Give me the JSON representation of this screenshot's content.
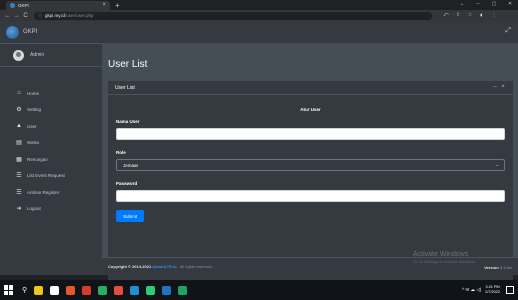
{
  "browser": {
    "tab_title": "GKPI",
    "tab_close": "×",
    "new_tab": "+",
    "window_controls": [
      "⌄",
      "–",
      "▢",
      "✕"
    ],
    "back": "←",
    "forward": "→",
    "reload": "C",
    "lock": "ⓘ",
    "url_host": "gkpi.my.id",
    "url_path": "/user/user.php",
    "toolbar_icons": [
      "⤺",
      "⇪",
      "☆"
    ],
    "profile": "◐",
    "menu": "⋮"
  },
  "topnav": {
    "brand": "GKPI",
    "expand_icon": "⤢"
  },
  "sidebar": {
    "user": "Admin",
    "items": [
      {
        "icon": "⌂",
        "label": "Home"
      },
      {
        "icon": "⚙",
        "label": "Setting"
      },
      {
        "icon": "▲",
        "label": "User"
      },
      {
        "icon": "▤",
        "label": "Warta"
      },
      {
        "icon": "▦",
        "label": "Renungan"
      },
      {
        "icon": "☰",
        "label": "List Event Request"
      },
      {
        "icon": "☰",
        "label": "Antrian Register"
      },
      {
        "icon": "➜",
        "label": "Logout"
      }
    ]
  },
  "main": {
    "page_title": "User List",
    "card": {
      "title": "User List",
      "collapse": "–",
      "close": "×",
      "form_heading": "Atur User",
      "fields": {
        "name_label": "Nama User",
        "name_value": "",
        "role_label": "Role",
        "role_value": "Jemaat",
        "password_label": "Password",
        "password_value": ""
      },
      "submit": "Submit"
    }
  },
  "footer": {
    "copyright_prefix": "Copyright © 2014-2021",
    "copyright_link": "AdminLTE.io.",
    "copyright_rights": "All rights reserved.",
    "version_label": "Version",
    "version_number": "3.1.0rc"
  },
  "watermark": {
    "title": "Activate Windows",
    "subtitle": "Go to Settings to activate Windows."
  },
  "taskbar": {
    "search_icon": "⚲",
    "tray_symbols": "^ ✉ ☁ ◁)",
    "time": "3:21 PM",
    "date": "2/7/2022",
    "app_colors": [
      "#f0c419",
      "#ffffff",
      "#e8562b",
      "#d83b27",
      "#27ae60",
      "#e84c3d",
      "#1e90d6",
      "#2ecc71",
      "#2471c2",
      "#21a366"
    ]
  }
}
